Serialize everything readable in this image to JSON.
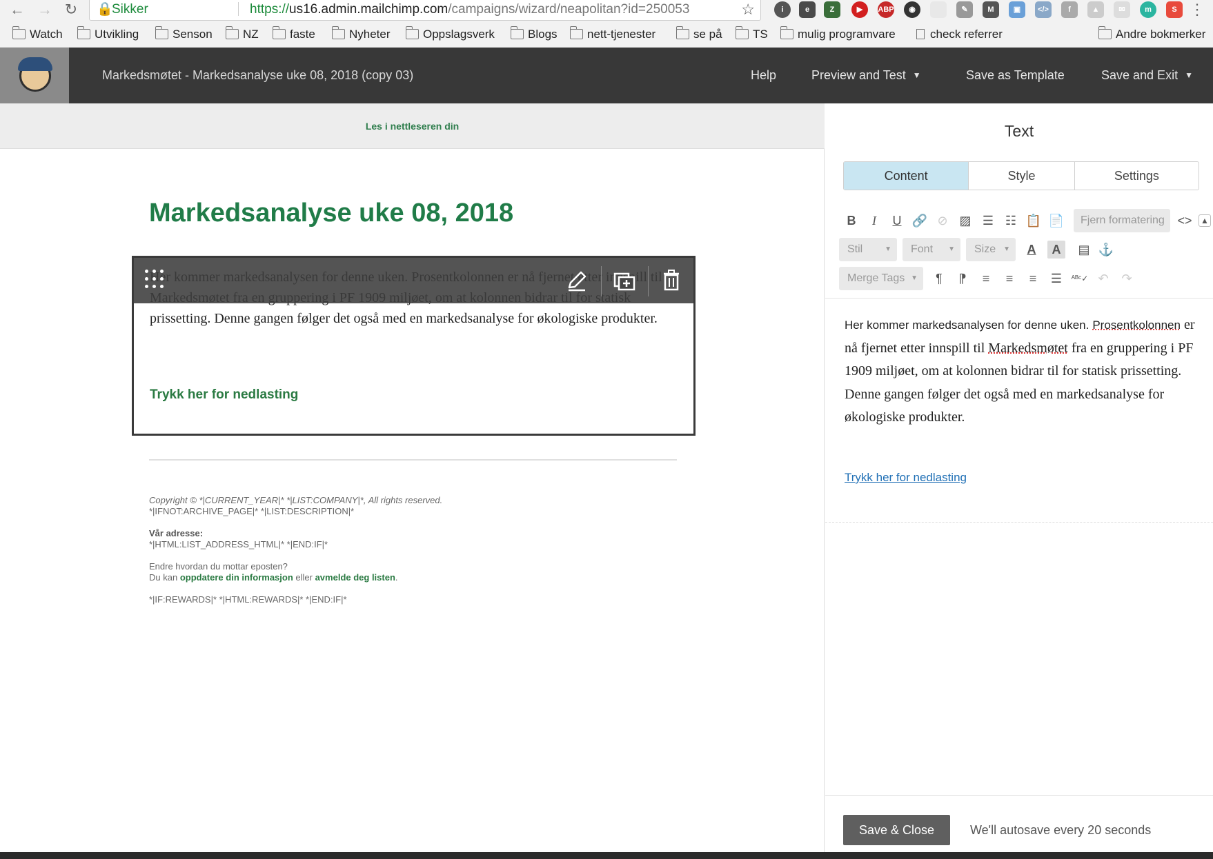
{
  "browser": {
    "secure_label": "Sikker",
    "url_scheme": "https://",
    "url_host": "us16.admin.mailchimp.com",
    "url_path": "/campaigns/wizard/neapolitan?id=250053",
    "bookmarks": [
      "Watch",
      "Utvikling",
      "Senson",
      "NZ",
      "faste",
      "Nyheter",
      "Oppslagsverk",
      "Blogs",
      "nett-tjenester",
      "se på",
      "TS",
      "mulig programvare",
      "check referrer"
    ],
    "other_bookmarks": "Andre bokmerker"
  },
  "app": {
    "campaign_title": "Markedsmøtet - Markedsanalyse uke 08, 2018 (copy 03)",
    "nav": {
      "help": "Help",
      "preview": "Preview and Test",
      "save_template": "Save as Template",
      "save_exit": "Save and Exit"
    }
  },
  "email": {
    "preheader_link": "Les i nettleseren din",
    "heading": "Markedsanalyse uke 08, 2018",
    "body": "Her kommer markedsanalysen for denne uken. Prosentkolonnen er nå fjernet etter innspill til Markedsmøtet fra en gruppering i PF 1909 miljøet, om at kolonnen bidrar til for statisk prissetting. Denne gangen følger det også med en markedsanalyse for økologiske produkter.",
    "download_link": "Trykk her for nedlasting",
    "footer": {
      "copyright": "Copyright © *|CURRENT_YEAR|* *|LIST:COMPANY|*, All rights reserved.",
      "archive": "*|IFNOT:ARCHIVE_PAGE|* *|LIST:DESCRIPTION|*",
      "address_label": "Vår adresse:",
      "address_value": "*|HTML:LIST_ADDRESS_HTML|* *|END:IF|*",
      "change_question": "Endre hvordan du mottar eposten?",
      "change_prefix": "Du kan ",
      "update_link": "oppdatere din informasjon",
      "or_text": " eller ",
      "unsubscribe_link": "avmelde deg listen",
      "period": ".",
      "rewards": "*|IF:REWARDS|* *|HTML:REWARDS|* *|END:IF|*"
    }
  },
  "panel": {
    "title": "Text",
    "tabs": [
      "Content",
      "Style",
      "Settings"
    ],
    "active_tab": "Content",
    "remove_formatting": "Fjern formatering",
    "source_icon": "<>",
    "selects": {
      "style": "Stil",
      "font": "Font",
      "size": "Size",
      "merge_tags": "Merge Tags"
    },
    "editor": {
      "line1_sans": "Her kommer markedsanalysen for denne uken.",
      "line1_word": "Prosentkolonnen",
      "rest_a": "er nå fjernet etter innspill til ",
      "word_spell": "Markedsmøtet",
      "rest_b": " fra en gruppering i PF 1909 miljøet, om at kolonnen bidrar til for statisk prissetting. Denne gangen følger det også med en markedsanalyse for økologiske produkter.",
      "link": "Trykk her for nedlasting"
    },
    "save_close": "Save & Close",
    "autosave": "We'll autosave every 20 seconds"
  }
}
